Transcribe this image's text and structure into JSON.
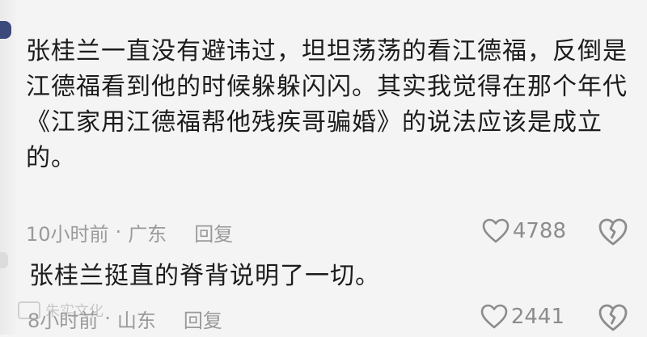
{
  "comments": [
    {
      "text": "张桂兰一直没有避讳过，坦坦荡荡的看江德福，反倒是江德福看到他的时候躲躲闪闪。其实我觉得在那个年代《江家用江德福帮他残疾哥骗婚》的说法应该是成立的。",
      "time": "10小时前",
      "separator": "·",
      "location": "广东",
      "reply_label": "回复",
      "likes": "4788",
      "like_icon": "heart-outline-icon",
      "dislike_icon": "broken-heart-icon"
    },
    {
      "text": "张桂兰挺直的脊背说明了一切。",
      "time": "8小时前",
      "separator": "·",
      "location": "山东",
      "reply_label": "回复",
      "likes": "2441",
      "like_icon": "heart-outline-icon",
      "dislike_icon": "broken-heart-icon"
    }
  ],
  "watermark": {
    "text": "朱实文化"
  },
  "colors": {
    "text": "#1c1c1c",
    "meta": "#9a9a9a",
    "background": "#f4f4f4"
  }
}
